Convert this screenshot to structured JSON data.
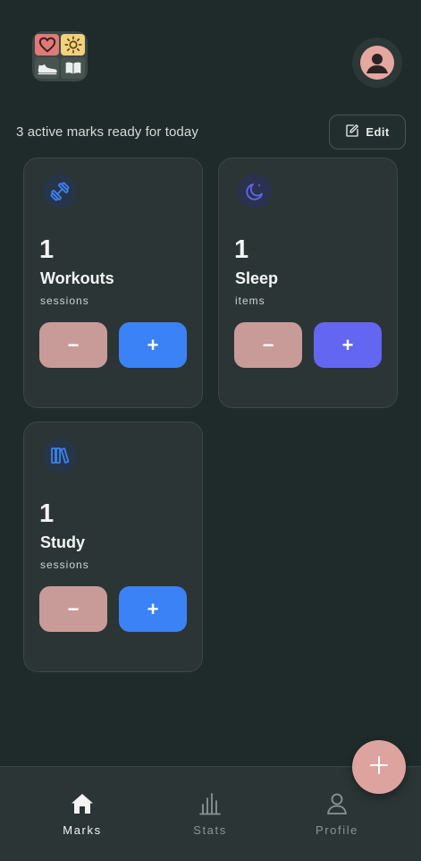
{
  "header": {
    "logo_icons": [
      "heart-icon",
      "sun-icon",
      "sneaker-icon",
      "book-icon"
    ],
    "avatar_icon": "user-icon",
    "subtitle": "3 active marks ready for today",
    "edit_label": "Edit",
    "edit_icon": "edit-icon"
  },
  "cards": [
    {
      "icon": "dumbbell-icon",
      "count": "1",
      "name": "Workouts",
      "unit": "sessions",
      "minus": "−",
      "plus": "+",
      "accent": "#3b82f6"
    },
    {
      "icon": "moon-icon",
      "count": "1",
      "name": "Sleep",
      "unit": "items",
      "minus": "−",
      "plus": "+",
      "accent": "#6366f1"
    },
    {
      "icon": "books-icon",
      "count": "1",
      "name": "Study",
      "unit": "sessions",
      "minus": "−",
      "plus": "+",
      "accent": "#3b82f6"
    }
  ],
  "fab": {
    "icon": "plus-icon",
    "color": "#dca39f"
  },
  "nav": {
    "items": [
      {
        "label": "Marks",
        "icon": "home-icon",
        "active": true
      },
      {
        "label": "Stats",
        "icon": "bar-chart-icon",
        "active": false
      },
      {
        "label": "Profile",
        "icon": "person-icon",
        "active": false
      }
    ]
  },
  "colors": {
    "background": "#1f2a2a",
    "card": "#2b3535",
    "minus_button": "#c99b98",
    "avatar": "#e4a8a1"
  }
}
